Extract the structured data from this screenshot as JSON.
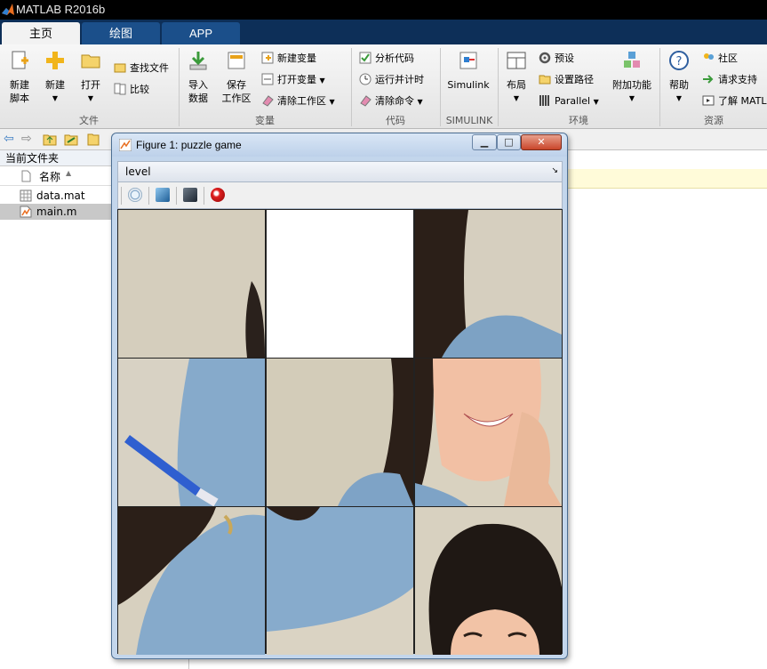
{
  "app": {
    "title": "MATLAB R2016b"
  },
  "tabs": [
    {
      "label": "主页",
      "active": true
    },
    {
      "label": "绘图",
      "active": false
    },
    {
      "label": "APP",
      "active": false
    }
  ],
  "ribbon": {
    "file": {
      "section": "文件",
      "new_script": "新建\n脚本",
      "new": "新建",
      "open": "打开",
      "find_files": "查找文件",
      "compare": "比较"
    },
    "variable": {
      "section": "变量",
      "import": "导入\n数据",
      "save_ws": "保存\n工作区",
      "new_var": "新建变量",
      "open_var": "打开变量",
      "clear_ws": "清除工作区"
    },
    "code": {
      "section": "代码",
      "analyze": "分析代码",
      "run_time": "运行并计时",
      "clear_cmd": "清除命令"
    },
    "simulink": {
      "section": "SIMULINK",
      "label": "Simulink"
    },
    "env": {
      "section": "环境",
      "layout": "布局",
      "prefs": "预设",
      "set_path": "设置路径",
      "parallel": "Parallel",
      "addons": "附加功能"
    },
    "resources": {
      "section": "资源",
      "help": "帮助",
      "community": "社区",
      "support": "请求支持",
      "learn": "了解 MATL"
    }
  },
  "current_folder": {
    "title": "当前文件夹",
    "col_name": "名称",
    "files": [
      {
        "name": "data.mat",
        "icon": "mat-file-icon",
        "selected": false
      },
      {
        "name": "main.m",
        "icon": "m-file-icon",
        "selected": true
      }
    ]
  },
  "figure": {
    "title": "Figure 1: puzzle game",
    "menu": "level",
    "buttons": {
      "minimize": "▁",
      "maximize": "□",
      "close": "✕"
    },
    "toolbar": [
      "circle-icon",
      "blue-square-icon",
      "dark-square-icon",
      "red-record-icon"
    ],
    "blank_tile": 1
  },
  "colors": {
    "tab_bar": "#0d2f58",
    "tab_active": "#f2f2f2",
    "window_frame": "#c3d6ec",
    "highlight_row": "#fffbd9"
  }
}
